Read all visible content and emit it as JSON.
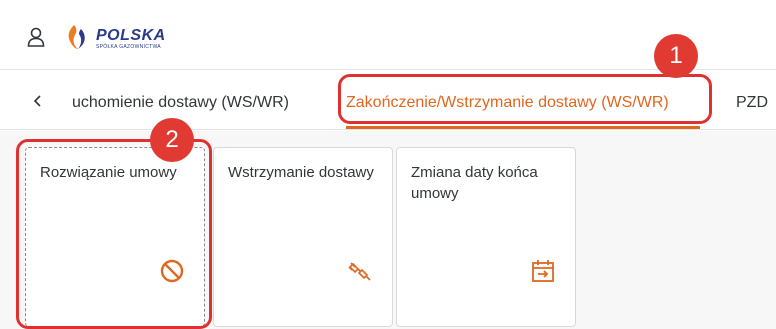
{
  "header": {
    "logo_text": "POLSKA",
    "logo_subtext": "SPÓŁKA GAZOWNICTWA"
  },
  "tabs": [
    {
      "label": "uchomienie dostawy (WS/WR)",
      "selected": false
    },
    {
      "label": "Zakończenie/Wstrzymanie dostawy (WS/WR)",
      "selected": true
    },
    {
      "label": "PZD",
      "selected": false
    }
  ],
  "tiles": [
    {
      "title": "Rozwiązanie umowy",
      "icon": "prohibited-icon"
    },
    {
      "title": "Wstrzymanie dostawy",
      "icon": "unplug-icon"
    },
    {
      "title": "Zmiana daty końca umowy",
      "icon": "calendar-arrow-icon"
    }
  ],
  "annotations": {
    "marker_1": "1",
    "marker_2": "2"
  },
  "colors": {
    "accent": "#e0671d",
    "highlight": "#e03131",
    "logo": "#2a3a8c"
  }
}
